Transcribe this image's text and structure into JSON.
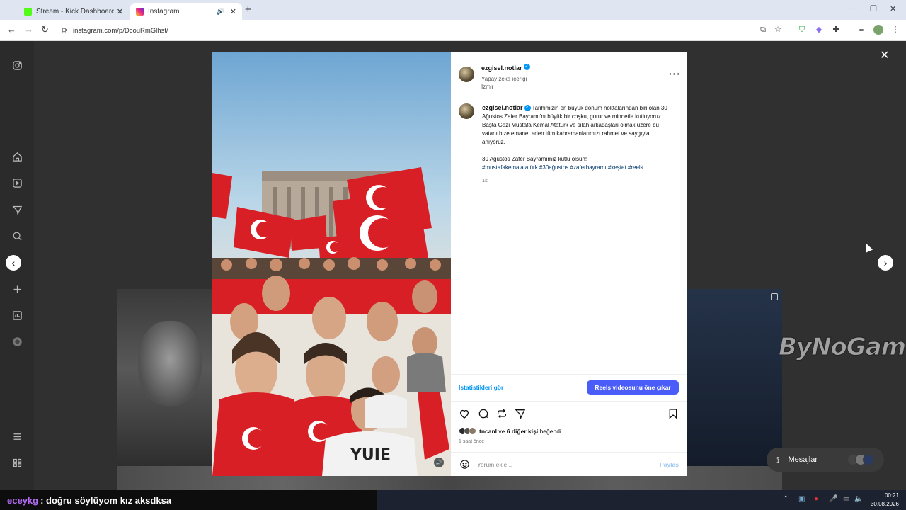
{
  "browser": {
    "tabs": [
      {
        "label": "Stream - Kick Dashboard",
        "favicon_color": "#53fc18"
      },
      {
        "label": "Instagram",
        "favicon_color": "#e1306c",
        "active": true
      }
    ],
    "url": "instagram.com/p/DcouRmGlhst/"
  },
  "post": {
    "username": "ezgisel.notlar",
    "subtitle": "Yapay zeka içeriği",
    "location": "İzmir",
    "caption_text": "Tarihimizin en büyük dönüm noktalarından biri olan 30 Ağustos Zafer Bayramı'nı büyük bir coşku, gurur ve minnetle kutluyoruz. Başta Gazi Mustafa Kemal Atatürk ve silah arkadaşları olmak üzere bu vatanı bize emanet eden tüm kahramanlarımızı rahmet ve saygıyla anıyoruz.",
    "caption_line2": "30 Ağustos Zafer Bayramımız kutlu olsun!",
    "hashtags": "#mustafakemalatatürk #30ağustos #zaferbayramı #keşfet #reels",
    "caption_time": "1s",
    "stats_link": "İstatistikleri gör",
    "boost_button": "Reels videosunu öne çıkar",
    "liked_by_user": "tncanl",
    "liked_by_rest": "ve",
    "liked_by_others": "6 diğer kişi",
    "liked_by_suffix": "beğendi",
    "posted_ago": "1 saat önce",
    "comment_placeholder": "Yorum ekle...",
    "share_label": "Paylaş"
  },
  "overlay": {
    "watermark": "ByNoGame",
    "messages_label": "Mesajlar",
    "chat_user": "eceykg",
    "chat_message": ": doğru söylüyom kız aksdksa"
  },
  "taskbar": {
    "time": "00:21",
    "date": "30.08.2026"
  },
  "colors": {
    "accent_blue": "#0095f6",
    "boost_blue": "#4a5df9",
    "chat_user": "#b46cf5"
  }
}
